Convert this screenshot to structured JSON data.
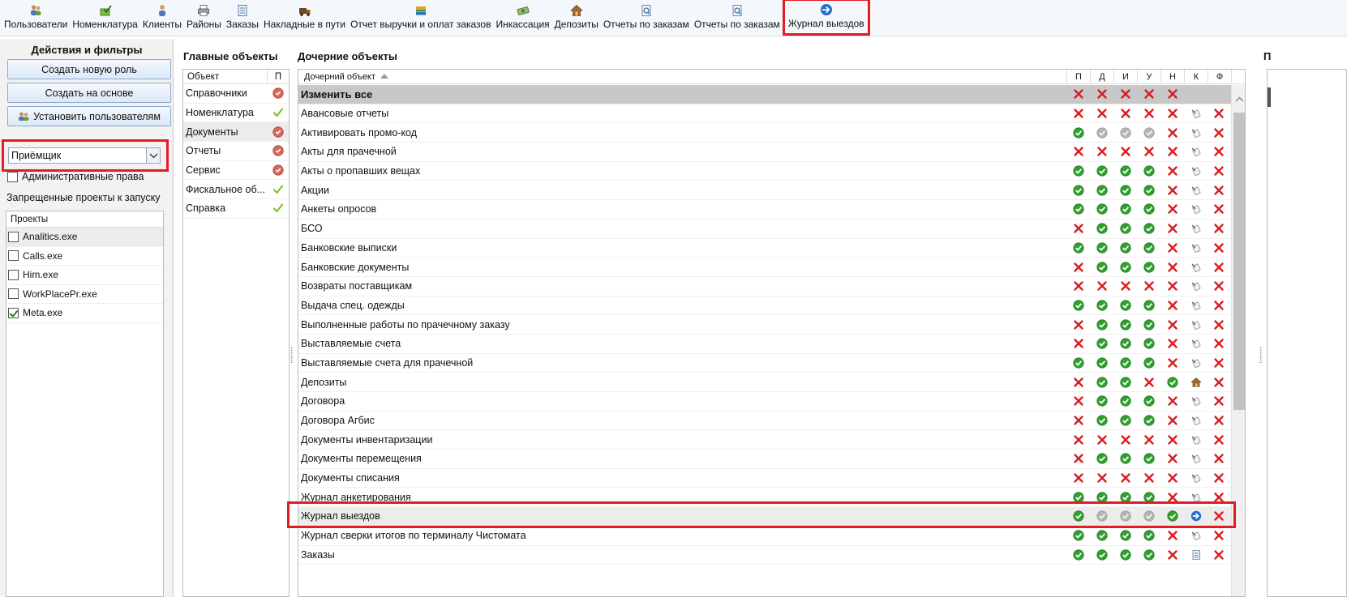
{
  "toolbar": [
    {
      "name": "tb-users",
      "icon": "users-icon",
      "label": "Пользователи"
    },
    {
      "name": "tb-nomenclature",
      "icon": "checkbook-icon",
      "label": "Номенклатура"
    },
    {
      "name": "tb-clients",
      "icon": "person-icon",
      "label": "Клиенты"
    },
    {
      "name": "tb-districts",
      "icon": "printer-icon",
      "label": "Районы"
    },
    {
      "name": "tb-orders",
      "icon": "document-icon",
      "label": "Заказы"
    },
    {
      "name": "tb-waybills",
      "icon": "truck-icon",
      "label": "Накладные в пути"
    },
    {
      "name": "tb-revenue-report",
      "icon": "books-icon",
      "label": "Отчет выручки и оплат заказов"
    },
    {
      "name": "tb-collection",
      "icon": "money-icon",
      "label": "Инкассация"
    },
    {
      "name": "tb-deposits",
      "icon": "house-icon",
      "label": "Депозиты"
    },
    {
      "name": "tb-orders-report-1",
      "icon": "report-icon",
      "label": "Отчеты по заказам"
    },
    {
      "name": "tb-orders-report-2",
      "icon": "report-icon",
      "label": "Отчеты по заказам"
    },
    {
      "name": "tb-trip-journal",
      "icon": "arrow-right-icon",
      "label": "Журнал выездов",
      "active": true
    }
  ],
  "left": {
    "title": "Действия и фильтры",
    "create_role": "Создать новую роль",
    "create_based": "Создать на основе",
    "set_users": "Установить пользователям",
    "role_value": "Приёмщик",
    "admin_rights": "Административные права",
    "forbidden_label": "Запрещенные проекты к запуску",
    "projects_header": "Проекты",
    "projects": [
      {
        "label": "Analitics.exe",
        "checked": false,
        "selected": true
      },
      {
        "label": "Calls.exe",
        "checked": false
      },
      {
        "label": "Him.exe",
        "checked": false
      },
      {
        "label": "WorkPlacePr.exe",
        "checked": false
      },
      {
        "label": "Meta.exe",
        "checked": true
      }
    ]
  },
  "main": {
    "title": "Главные объекты",
    "col_object": "Объект",
    "col_p": "П",
    "rows": [
      {
        "label": "Справочники",
        "status": "deny"
      },
      {
        "label": "Номенклатура",
        "status": "check"
      },
      {
        "label": "Документы",
        "status": "deny",
        "selected": true
      },
      {
        "label": "Отчеты",
        "status": "deny"
      },
      {
        "label": "Сервис",
        "status": "deny"
      },
      {
        "label": "Фискальное об...",
        "status": "check"
      },
      {
        "label": "Справка",
        "status": "check"
      }
    ]
  },
  "child": {
    "title": "Дочерние объекты",
    "col_name": "Дочерний объект",
    "cols": [
      "П",
      "Д",
      "И",
      "У",
      "Н",
      "К",
      "Ф"
    ],
    "rows": [
      {
        "label": "Изменить все",
        "header": true,
        "v": [
          "x",
          "x",
          "x",
          "x",
          "x",
          "",
          ""
        ]
      },
      {
        "label": "Авансовые отчеты",
        "v": [
          "x",
          "x",
          "x",
          "x",
          "x",
          "tool",
          "x"
        ]
      },
      {
        "label": "Активировать промо-код",
        "v": [
          "g",
          "n",
          "n",
          "n",
          "x",
          "tool",
          "x"
        ]
      },
      {
        "label": "Акты для прачечной",
        "v": [
          "x",
          "x",
          "x",
          "x",
          "x",
          "tool",
          "x"
        ]
      },
      {
        "label": "Акты о пропавших вещах",
        "v": [
          "g",
          "g",
          "g",
          "g",
          "x",
          "tool",
          "x"
        ]
      },
      {
        "label": "Акции",
        "v": [
          "g",
          "g",
          "g",
          "g",
          "x",
          "tool",
          "x"
        ]
      },
      {
        "label": "Анкеты опросов",
        "v": [
          "g",
          "g",
          "g",
          "g",
          "x",
          "tool",
          "x"
        ]
      },
      {
        "label": "БСО",
        "v": [
          "x",
          "g",
          "g",
          "g",
          "x",
          "tool",
          "x"
        ]
      },
      {
        "label": "Банковские выписки",
        "v": [
          "g",
          "g",
          "g",
          "g",
          "x",
          "tool",
          "x"
        ]
      },
      {
        "label": "Банковские документы",
        "v": [
          "x",
          "g",
          "g",
          "g",
          "x",
          "tool",
          "x"
        ]
      },
      {
        "label": "Возвраты поставщикам",
        "v": [
          "x",
          "x",
          "x",
          "x",
          "x",
          "tool",
          "x"
        ]
      },
      {
        "label": "Выдача спец. одежды",
        "v": [
          "g",
          "g",
          "g",
          "g",
          "x",
          "tool",
          "x"
        ]
      },
      {
        "label": "Выполненные работы по прачечному заказу",
        "v": [
          "x",
          "g",
          "g",
          "g",
          "x",
          "tool",
          "x"
        ]
      },
      {
        "label": "Выставляемые счета",
        "v": [
          "x",
          "g",
          "g",
          "g",
          "x",
          "tool",
          "x"
        ]
      },
      {
        "label": "Выставляемые счета для прачечной",
        "v": [
          "g",
          "g",
          "g",
          "g",
          "x",
          "tool",
          "x"
        ]
      },
      {
        "label": "Депозиты",
        "v": [
          "x",
          "g",
          "g",
          "x",
          "g",
          "house",
          "x"
        ]
      },
      {
        "label": "Договора",
        "v": [
          "x",
          "g",
          "g",
          "g",
          "x",
          "tool",
          "x"
        ]
      },
      {
        "label": "Договора Агбис",
        "v": [
          "x",
          "g",
          "g",
          "g",
          "x",
          "tool",
          "x"
        ]
      },
      {
        "label": "Документы инвентаризации",
        "v": [
          "x",
          "x",
          "x",
          "x",
          "x",
          "tool",
          "x"
        ]
      },
      {
        "label": "Документы перемещения",
        "v": [
          "x",
          "g",
          "g",
          "g",
          "x",
          "tool",
          "x"
        ]
      },
      {
        "label": "Документы списания",
        "v": [
          "x",
          "x",
          "x",
          "x",
          "x",
          "tool",
          "x"
        ]
      },
      {
        "label": "Журнал анкетирования",
        "v": [
          "g",
          "g",
          "g",
          "g",
          "x",
          "tool",
          "x"
        ]
      },
      {
        "label": "Журнал выездов",
        "selected": true,
        "v": [
          "g",
          "n",
          "n",
          "n",
          "g",
          "arrow",
          "x"
        ]
      },
      {
        "label": "Журнал сверки итогов по терминалу Чистомата",
        "v": [
          "g",
          "g",
          "g",
          "g",
          "x",
          "tool",
          "x"
        ]
      },
      {
        "label": "Заказы",
        "v": [
          "g",
          "g",
          "g",
          "g",
          "x",
          "doc",
          "x"
        ]
      }
    ]
  },
  "right": {
    "title": "П"
  },
  "colors": {
    "accent": "#e31b23",
    "green": "#2fa12f",
    "deny": "#d81e1e",
    "neutral": "#9d9d9d",
    "blue": "#1f6fd1"
  }
}
